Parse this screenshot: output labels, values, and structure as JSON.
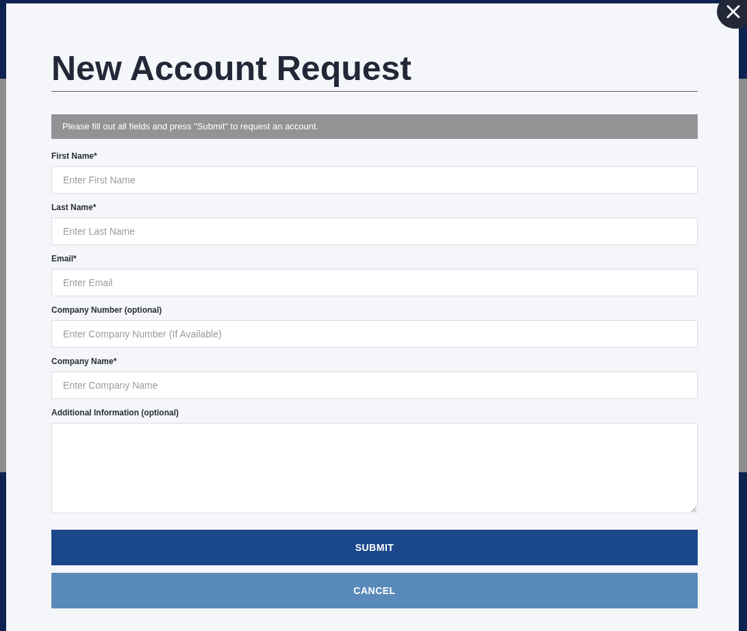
{
  "dialog": {
    "title": "New Account Request",
    "notice": "Please fill out all fields and press \"Submit\" to request an account.",
    "fields": [
      {
        "kind": "input",
        "label": "First Name*",
        "placeholder": "Enter First Name"
      },
      {
        "kind": "input",
        "label": "Last Name*",
        "placeholder": "Enter Last Name"
      },
      {
        "kind": "input",
        "label": "Email*",
        "placeholder": "Enter Email"
      },
      {
        "kind": "input",
        "label": "Company Number (optional)",
        "placeholder": "Enter Company Number (If Available)"
      },
      {
        "kind": "input",
        "label": "Company Name*",
        "placeholder": "Enter Company Name"
      },
      {
        "kind": "textarea",
        "label": "Additional Information (optional)"
      }
    ],
    "buttons": [
      {
        "kind": "primary",
        "label": "SUBMIT"
      },
      {
        "kind": "secondary",
        "label": "CANCEL"
      }
    ]
  }
}
